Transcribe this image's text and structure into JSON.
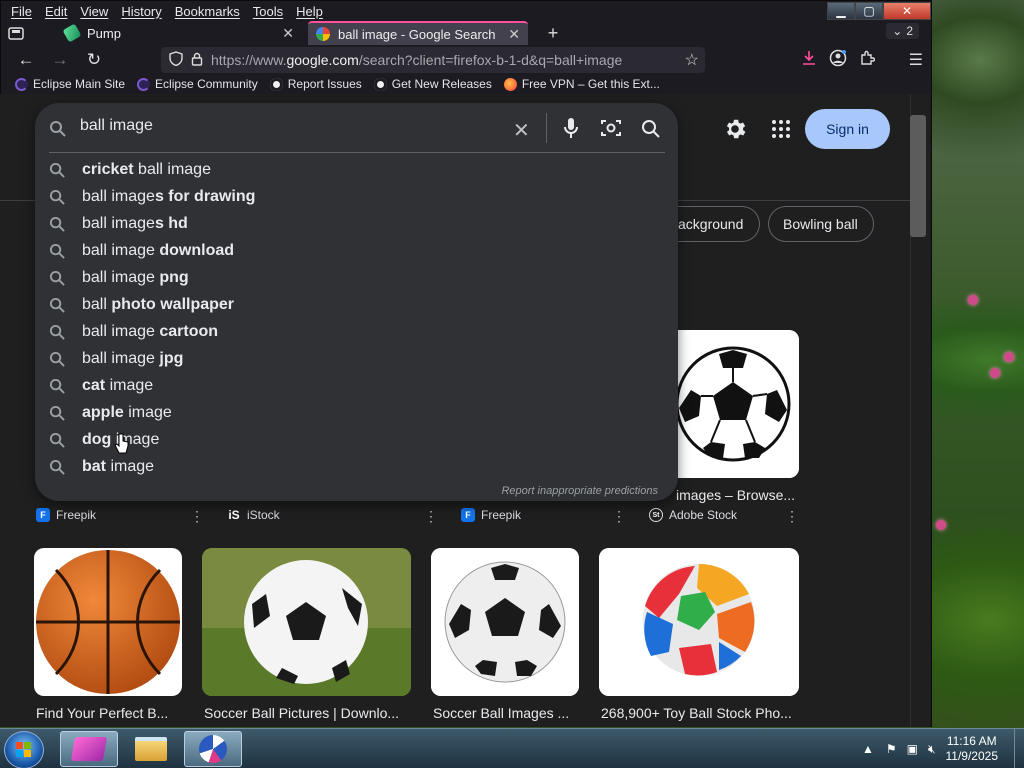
{
  "menu": [
    "File",
    "Edit",
    "View",
    "History",
    "Bookmarks",
    "Tools",
    "Help"
  ],
  "tabs": [
    {
      "title": "Pump",
      "active": false
    },
    {
      "title": "ball image - Google Search",
      "active": true
    }
  ],
  "tab_count": "2",
  "url": {
    "scheme": "https://www.",
    "host": "google.com",
    "path": "/search?client=firefox-b-1-d&q=ball+image"
  },
  "bookmarks": [
    {
      "label": "Eclipse Main Site",
      "color": "#3b2a5a"
    },
    {
      "label": "Eclipse Community",
      "color": "#3b2a5a"
    },
    {
      "label": "Report Issues",
      "color": "#f0f0f0"
    },
    {
      "label": "Get New Releases",
      "color": "#f0f0f0"
    },
    {
      "label": "Free VPN – Get this Ext...",
      "color": "#ff7139"
    }
  ],
  "search": {
    "query": "ball image",
    "suggestions": [
      {
        "bold_prefix": "cricket",
        "normal": " ball image",
        "bold_suffix": ""
      },
      {
        "bold_prefix": "",
        "normal": "ball image",
        "bold_suffix": "s for drawing"
      },
      {
        "bold_prefix": "",
        "normal": "ball image",
        "bold_suffix": "s hd"
      },
      {
        "bold_prefix": "",
        "normal": "ball image ",
        "bold_suffix": "download"
      },
      {
        "bold_prefix": "",
        "normal": "ball image ",
        "bold_suffix": "png"
      },
      {
        "bold_prefix": "",
        "normal": "ball ",
        "bold_suffix": "photo wallpaper"
      },
      {
        "bold_prefix": "",
        "normal": "ball image ",
        "bold_suffix": "cartoon"
      },
      {
        "bold_prefix": "",
        "normal": "ball image ",
        "bold_suffix": "jpg"
      },
      {
        "bold_prefix": "cat",
        "normal": " image",
        "bold_suffix": ""
      },
      {
        "bold_prefix": "apple",
        "normal": " image",
        "bold_suffix": ""
      },
      {
        "bold_prefix": "dog",
        "normal": " image",
        "bold_suffix": ""
      },
      {
        "bold_prefix": "bat",
        "normal": " image",
        "bold_suffix": ""
      }
    ],
    "report": "Report inappropriate predictions"
  },
  "chips": [
    "ackground",
    "Bowling ball"
  ],
  "signin": "Sign in",
  "row1_sources": [
    {
      "name": "Freepik",
      "color": "#1273eb",
      "glyph": "F"
    },
    {
      "name": "iStock",
      "color": "#1f1f1f",
      "glyph": "iS"
    },
    {
      "name": "Freepik",
      "color": "#1273eb",
      "glyph": "F"
    },
    {
      "name": "Adobe Stock",
      "color": "#1f1f1f",
      "glyph": "St"
    }
  ],
  "row1_visible_caption": "images – Browse...",
  "row2_captions": [
    "Find Your Perfect B...",
    "Soccer Ball Pictures | Downlo...",
    "Soccer Ball Images ...",
    "268,900+ Toy Ball Stock Pho..."
  ],
  "clock": {
    "time": "11:16 AM",
    "date": "11/9/2025"
  }
}
